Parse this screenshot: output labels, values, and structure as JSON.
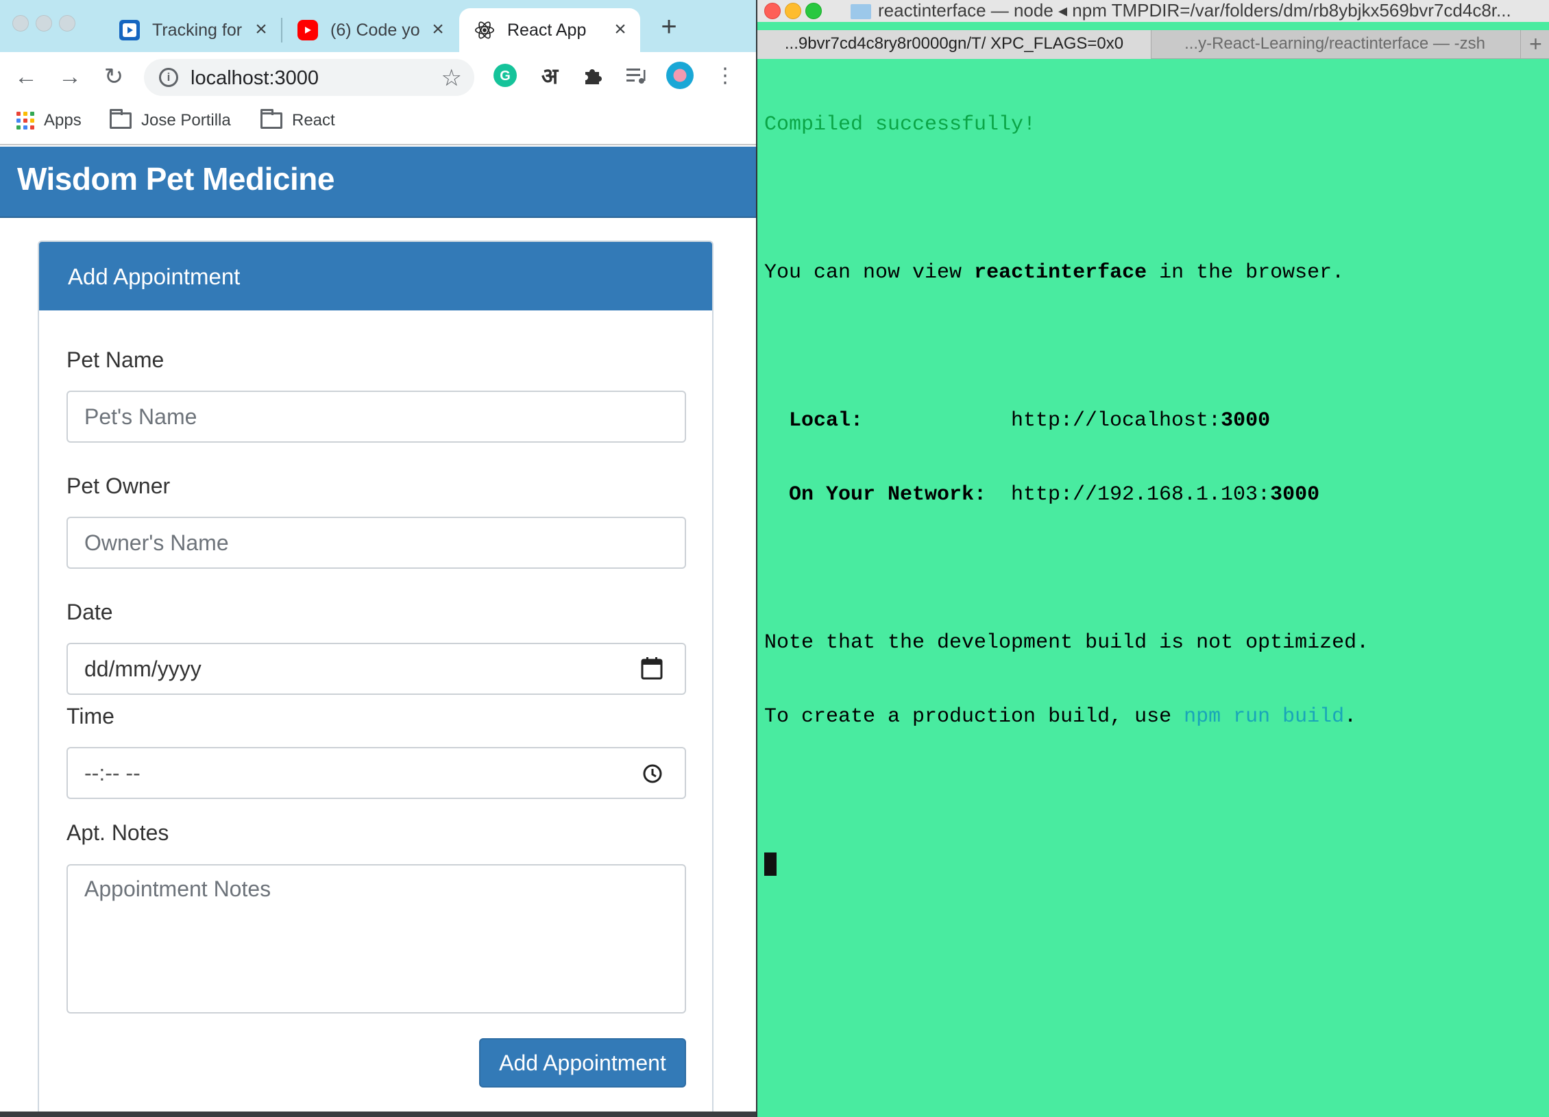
{
  "browser": {
    "tabs": [
      {
        "title": "Tracking for",
        "favicon": "play-badge-icon",
        "active": false
      },
      {
        "title": "(6) Code yo",
        "favicon": "youtube-icon",
        "active": false
      },
      {
        "title": "React App",
        "favicon": "react-icon",
        "active": true
      }
    ],
    "url": "localhost:3000",
    "bookmarks": [
      {
        "label": "Apps",
        "icon": "apps-grid-icon"
      },
      {
        "label": "Jose Portilla",
        "icon": "folder-icon"
      },
      {
        "label": "React",
        "icon": "folder-icon"
      }
    ],
    "extensions": {
      "hindi_glyph": "अ"
    }
  },
  "app": {
    "brand": "Wisdom Pet Medicine",
    "panel_title": "Add Appointment",
    "fields": {
      "pet_name": {
        "label": "Pet Name",
        "placeholder": "Pet's Name"
      },
      "pet_owner": {
        "label": "Pet Owner",
        "placeholder": "Owner's Name"
      },
      "date": {
        "label": "Date",
        "value": "dd/mm/yyyy"
      },
      "time": {
        "label": "Time",
        "value": "--:-- --"
      },
      "notes": {
        "label": "Apt. Notes",
        "placeholder": "Appointment Notes"
      }
    },
    "submit_label": "Add Appointment",
    "colors": {
      "primary": "#337ab7"
    }
  },
  "terminal": {
    "title": "reactinterface — node ◂ npm TMPDIR=/var/folders/dm/rb8ybjkx569bvr7cd4c8r...",
    "tabs": [
      {
        "label": "...9bvr7cd4c8ry8r0000gn/T/ XPC_FLAGS=0x0",
        "active": true
      },
      {
        "label": "...y-React-Learning/reactinterface — -zsh",
        "active": false
      }
    ],
    "lines": {
      "compiled": "Compiled successfully!",
      "view_prefix": "You can now view ",
      "view_app": "reactinterface",
      "view_suffix": " in the browser.",
      "local_label": "  Local:",
      "local_url": "http://localhost:",
      "local_port": "3000",
      "network_label": "  On Your Network:",
      "network_url": "http://192.168.1.103:",
      "network_port": "3000",
      "note1": "Note that the development build is not optimized.",
      "note2_prefix": "To create a production build, use ",
      "note2_cmd": "npm run build",
      "note2_suffix": "."
    },
    "colors": {
      "background": "#49eba0",
      "success": "#0aa546",
      "command": "#19a5b8"
    }
  }
}
